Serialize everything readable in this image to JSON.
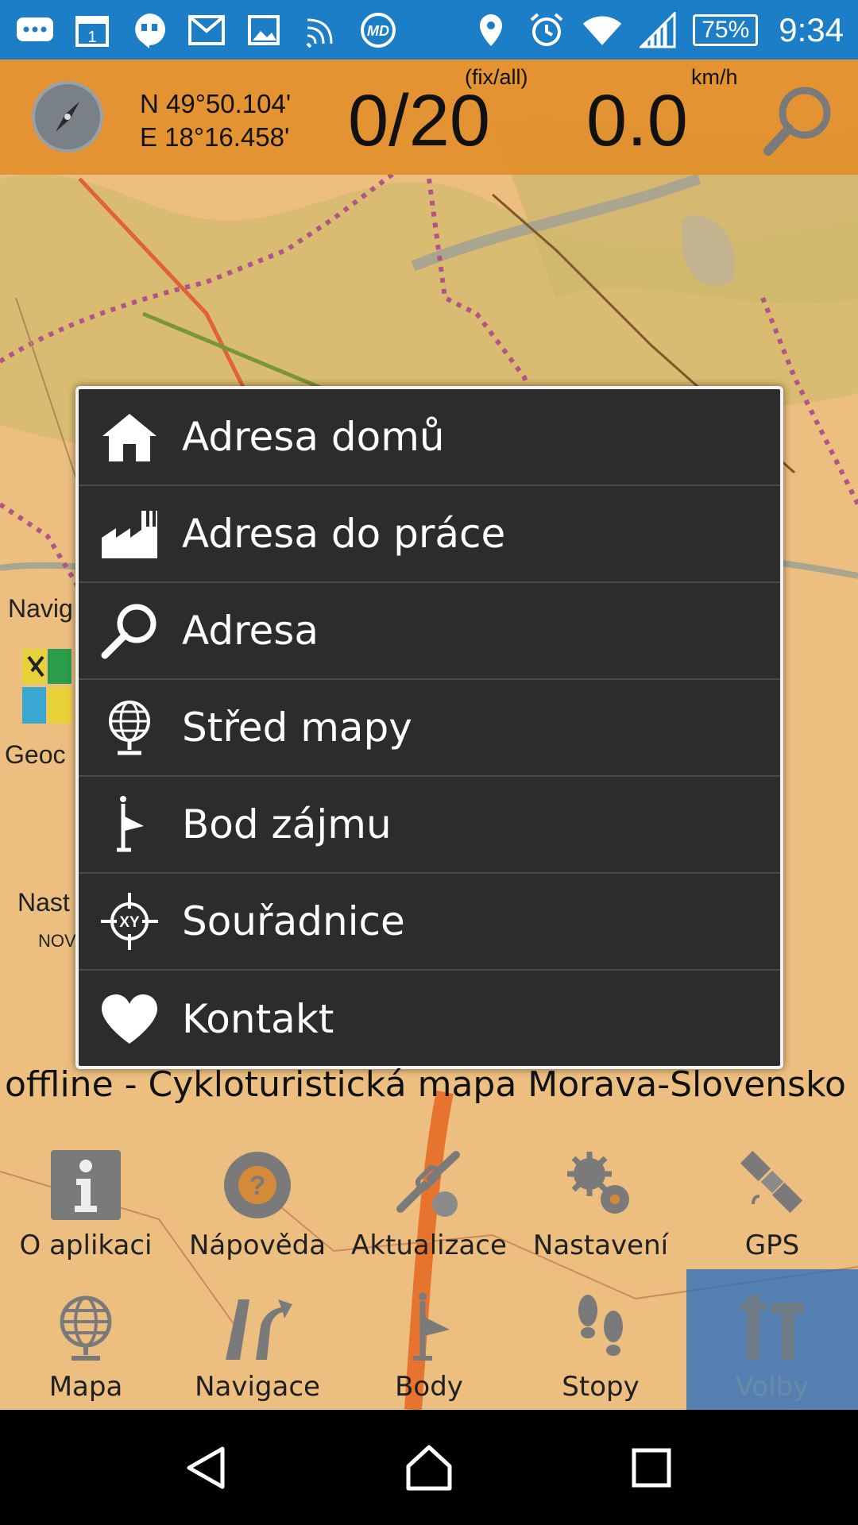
{
  "statusbar": {
    "icons": [
      "messages-icon",
      "calendar-icon",
      "hangouts-icon",
      "gmail-icon",
      "gallery-icon",
      "signal-waves-icon",
      "app-md-icon"
    ],
    "battery": "75%",
    "time": "9:34"
  },
  "topbar": {
    "lat": "N 49°50.104'",
    "lon": "E 18°16.458'",
    "sats_label": "(fix/all)",
    "sats_value": "0/20",
    "speed_label": "km/h",
    "speed_value": "0.0"
  },
  "side": {
    "navi": "Navig",
    "geo": "Geoc",
    "nast": "Nast",
    "nov": "NOV"
  },
  "dialog": {
    "items": [
      {
        "label": "Adresa domů",
        "icon": "home-icon"
      },
      {
        "label": "Adresa do práce",
        "icon": "factory-icon"
      },
      {
        "label": "Adresa",
        "icon": "search-icon"
      },
      {
        "label": "Střed mapy",
        "icon": "globe-icon"
      },
      {
        "label": "Bod zájmu",
        "icon": "poi-flag-icon"
      },
      {
        "label": "Souřadnice",
        "icon": "crosshair-xy-icon"
      },
      {
        "label": "Kontakt",
        "icon": "heart-icon"
      }
    ]
  },
  "caption": "offline - Cykloturistická mapa Morava-Slovensko ...",
  "menu": [
    {
      "label": "O aplikaci",
      "icon": "info-icon"
    },
    {
      "label": "Nápověda",
      "icon": "help-icon"
    },
    {
      "label": "Aktualizace",
      "icon": "update-icon"
    },
    {
      "label": "Nastavení",
      "icon": "settings-icon"
    },
    {
      "label": "GPS",
      "icon": "satellite-icon"
    },
    {
      "label": "Mapa",
      "icon": "globe-icon"
    },
    {
      "label": "Navigace",
      "icon": "navigation-icon"
    },
    {
      "label": "Body",
      "icon": "poi-flag-icon"
    },
    {
      "label": "Stopy",
      "icon": "footprints-icon"
    },
    {
      "label": "Volby",
      "icon": "options-icon"
    }
  ],
  "colors": {
    "statusbar": "#1d7ec8",
    "overlay": "#e28c26",
    "dialog": "#2c2c2c",
    "active": "#286ebe"
  }
}
